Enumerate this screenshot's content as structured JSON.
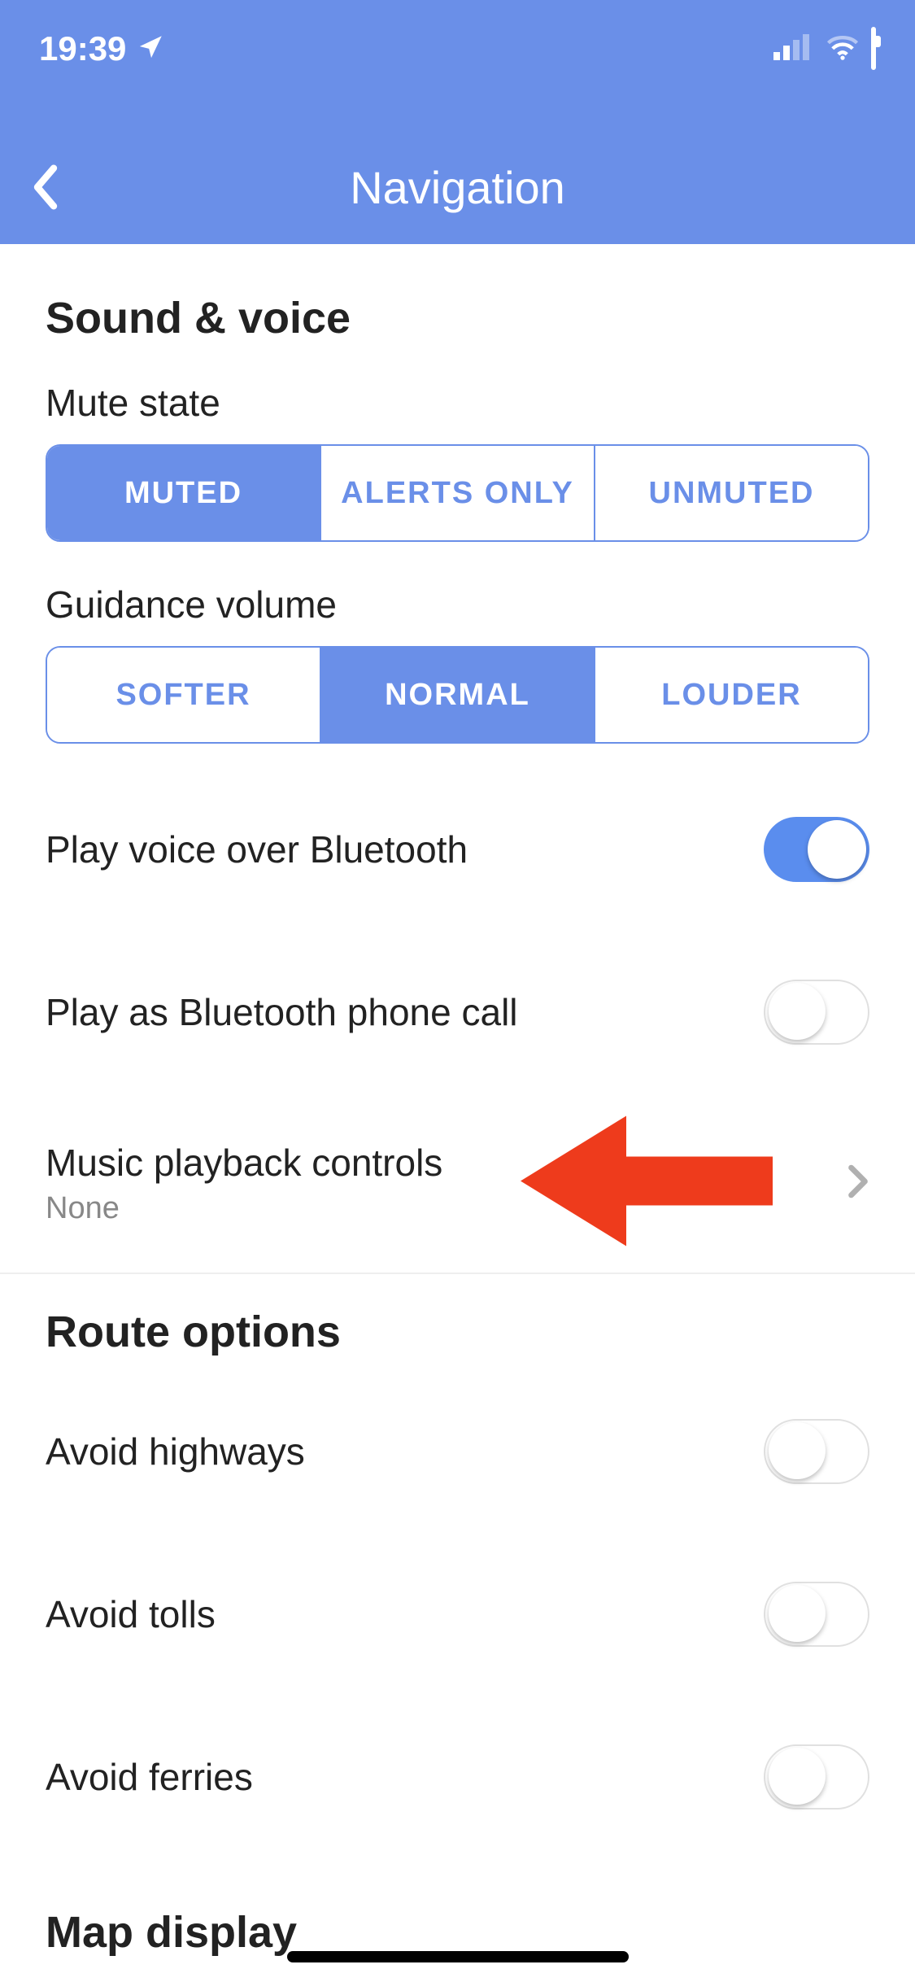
{
  "status": {
    "time": "19:39"
  },
  "header": {
    "title": "Navigation"
  },
  "sound": {
    "section_title": "Sound & voice",
    "mute_label": "Mute state",
    "mute_options": {
      "muted": "MUTED",
      "alerts": "ALERTS ONLY",
      "unmuted": "UNMUTED"
    },
    "volume_label": "Guidance volume",
    "volume_options": {
      "softer": "SOFTER",
      "normal": "NORMAL",
      "louder": "LOUDER"
    },
    "bluetooth_voice": "Play voice over Bluetooth",
    "bluetooth_call": "Play as Bluetooth phone call",
    "music": {
      "title": "Music playback controls",
      "value": "None"
    }
  },
  "route": {
    "section_title": "Route options",
    "highways": "Avoid highways",
    "tolls": "Avoid tolls",
    "ferries": "Avoid ferries"
  },
  "map": {
    "section_title": "Map display"
  }
}
